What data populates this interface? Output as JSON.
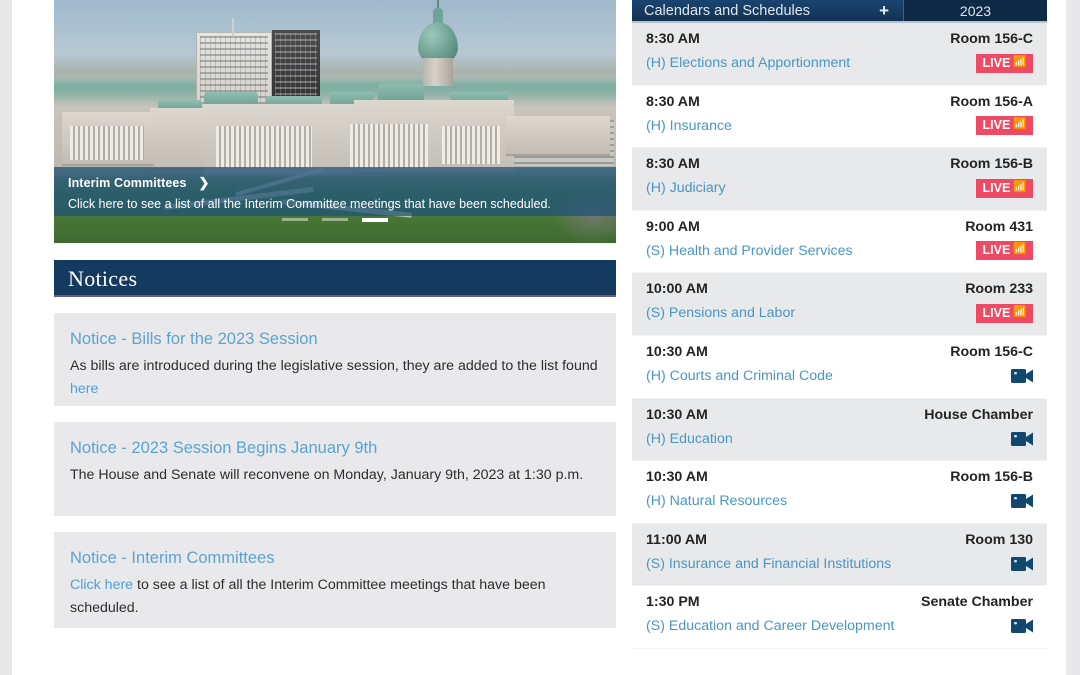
{
  "hero": {
    "slide_title": "Interim Committees",
    "chevron": "❯",
    "slide_text": "Click here to see a list of all the Interim Committee meetings that have been scheduled.",
    "slide_count": 3,
    "active_slide": 3
  },
  "notices": {
    "section_title": "Notices",
    "items": [
      {
        "title": "Notice - Bills for the 2023 Session",
        "body_before": "As bills are introduced during the legislative session, they are added to the list found ",
        "link": "here",
        "body_after": ""
      },
      {
        "title": "Notice - 2023 Session Begins January 9th",
        "body_before": "The House and Senate will reconvene on Monday, January 9th, 2023 at 1:30 p.m.",
        "link": "",
        "body_after": ""
      },
      {
        "title": "Notice - Interim Committees",
        "body_before": "",
        "link": "Click here",
        "body_after": " to see a list of all the Interim Committee meetings that have been scheduled."
      }
    ]
  },
  "calendar": {
    "header_title": "Calendars and Schedules",
    "add_label": "+",
    "year": "2023",
    "colors": {
      "header_bg": "#123354",
      "live_badge": "#ef4a63",
      "camera_icon": "#11486f",
      "link_blue": "#4a96c4",
      "row_alt_bg": "#e8e9ea"
    },
    "rows": [
      {
        "time": "8:30 AM",
        "committee": "(H) Elections and Apportionment",
        "room": "Room 156-C",
        "status": "LIVE"
      },
      {
        "time": "8:30 AM",
        "committee": "(H) Insurance",
        "room": "Room 156-A",
        "status": "LIVE"
      },
      {
        "time": "8:30 AM",
        "committee": "(H) Judiciary",
        "room": "Room 156-B",
        "status": "LIVE"
      },
      {
        "time": "9:00 AM",
        "committee": "(S) Health and Provider Services",
        "room": "Room 431",
        "status": "LIVE"
      },
      {
        "time": "10:00 AM",
        "committee": "(S) Pensions and Labor",
        "room": "Room 233",
        "status": "LIVE"
      },
      {
        "time": "10:30 AM",
        "committee": "(H) Courts and Criminal Code",
        "room": "Room 156-C",
        "status": "video"
      },
      {
        "time": "10:30 AM",
        "committee": "(H) Education",
        "room": "House Chamber",
        "status": "video"
      },
      {
        "time": "10:30 AM",
        "committee": "(H) Natural Resources",
        "room": "Room 156-B",
        "status": "video"
      },
      {
        "time": "11:00 AM",
        "committee": "(S) Insurance and Financial Institutions",
        "room": "Room 130",
        "status": "video"
      },
      {
        "time": "1:30 PM",
        "committee": "(S) Education and Career Development",
        "room": "Senate Chamber",
        "status": "video"
      }
    ],
    "live_label": "LIVE"
  }
}
